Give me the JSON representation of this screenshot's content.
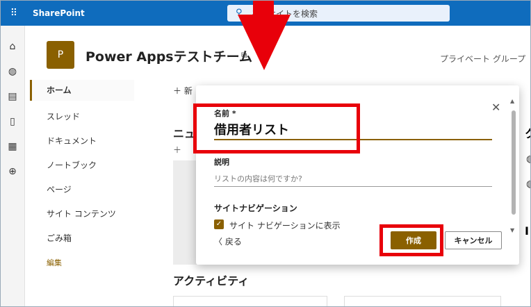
{
  "suite_bar": {
    "app_name": "SharePoint",
    "search_placeholder": "このサイトを検索"
  },
  "site": {
    "logo_letter": "P",
    "title": "Power Appsテストチーム",
    "privacy": "プライベート グループ"
  },
  "left_nav": {
    "items": [
      {
        "label": "ホーム",
        "active": true
      },
      {
        "label": "スレッド"
      },
      {
        "label": "ドキュメント"
      },
      {
        "label": "ノートブック"
      },
      {
        "label": "ページ"
      },
      {
        "label": "サイト コンテンツ"
      },
      {
        "label": "ごみ箱"
      }
    ],
    "edit_label": "編集"
  },
  "background": {
    "new_label": "新",
    "news_title": "ニュ",
    "activity_title": "アクティビティ"
  },
  "dialog": {
    "name_label": "名前 *",
    "name_value": "借用者リスト",
    "description_label": "説明",
    "description_placeholder": "リストの内容は何ですか?",
    "nav_section_label": "サイトナビゲーション",
    "show_in_nav_label": "サイト ナビゲーションに表示",
    "show_in_nav_checked": true,
    "back_label": "戻る",
    "create_label": "作成",
    "cancel_label": "キャンセル"
  },
  "icons": {
    "waffle": "waffle-icon",
    "search": "search-icon",
    "close": "close-icon",
    "back": "chevron-left-icon",
    "check": "checkmark-icon"
  },
  "colors": {
    "brand_blue": "#0f6cbd",
    "accent": "#8a6000",
    "annotation_red": "#e8000a"
  }
}
